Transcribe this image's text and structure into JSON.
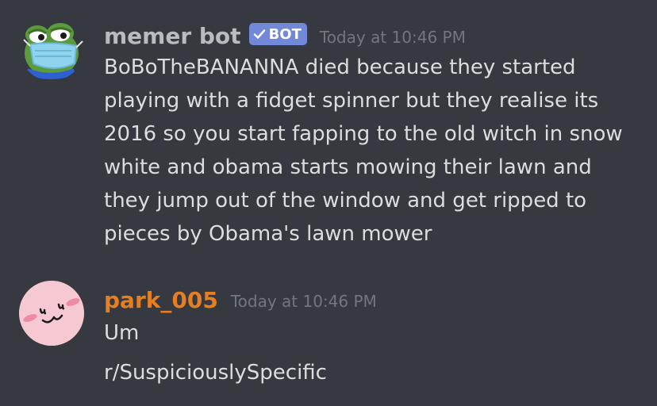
{
  "messages": [
    {
      "username": "memer bot",
      "badge": "BOT",
      "timestamp": "Today at 10:46 PM",
      "username_color": "#b9bbbe",
      "avatar_icon": "pepe-frog-mask-avatar",
      "lines": [
        "BoBoTheBANANNA died because they started",
        "playing with a fidget spinner but they realise its",
        "2016 so you start fapping to the old witch in snow",
        "white and obama starts mowing their lawn and",
        "they jump out of the window and get ripped to",
        "pieces by Obama's lawn mower"
      ]
    },
    {
      "username": "park_005",
      "timestamp": "Today at 10:46 PM",
      "username_color": "#e67e22",
      "avatar_icon": "pink-blush-face-avatar",
      "lines": [
        "Um",
        "r/SuspiciouslySpecific"
      ]
    }
  ],
  "colors": {
    "background": "#36393f",
    "text": "#dcddde",
    "timestamp": "#72767d",
    "badge": "#7289da"
  }
}
